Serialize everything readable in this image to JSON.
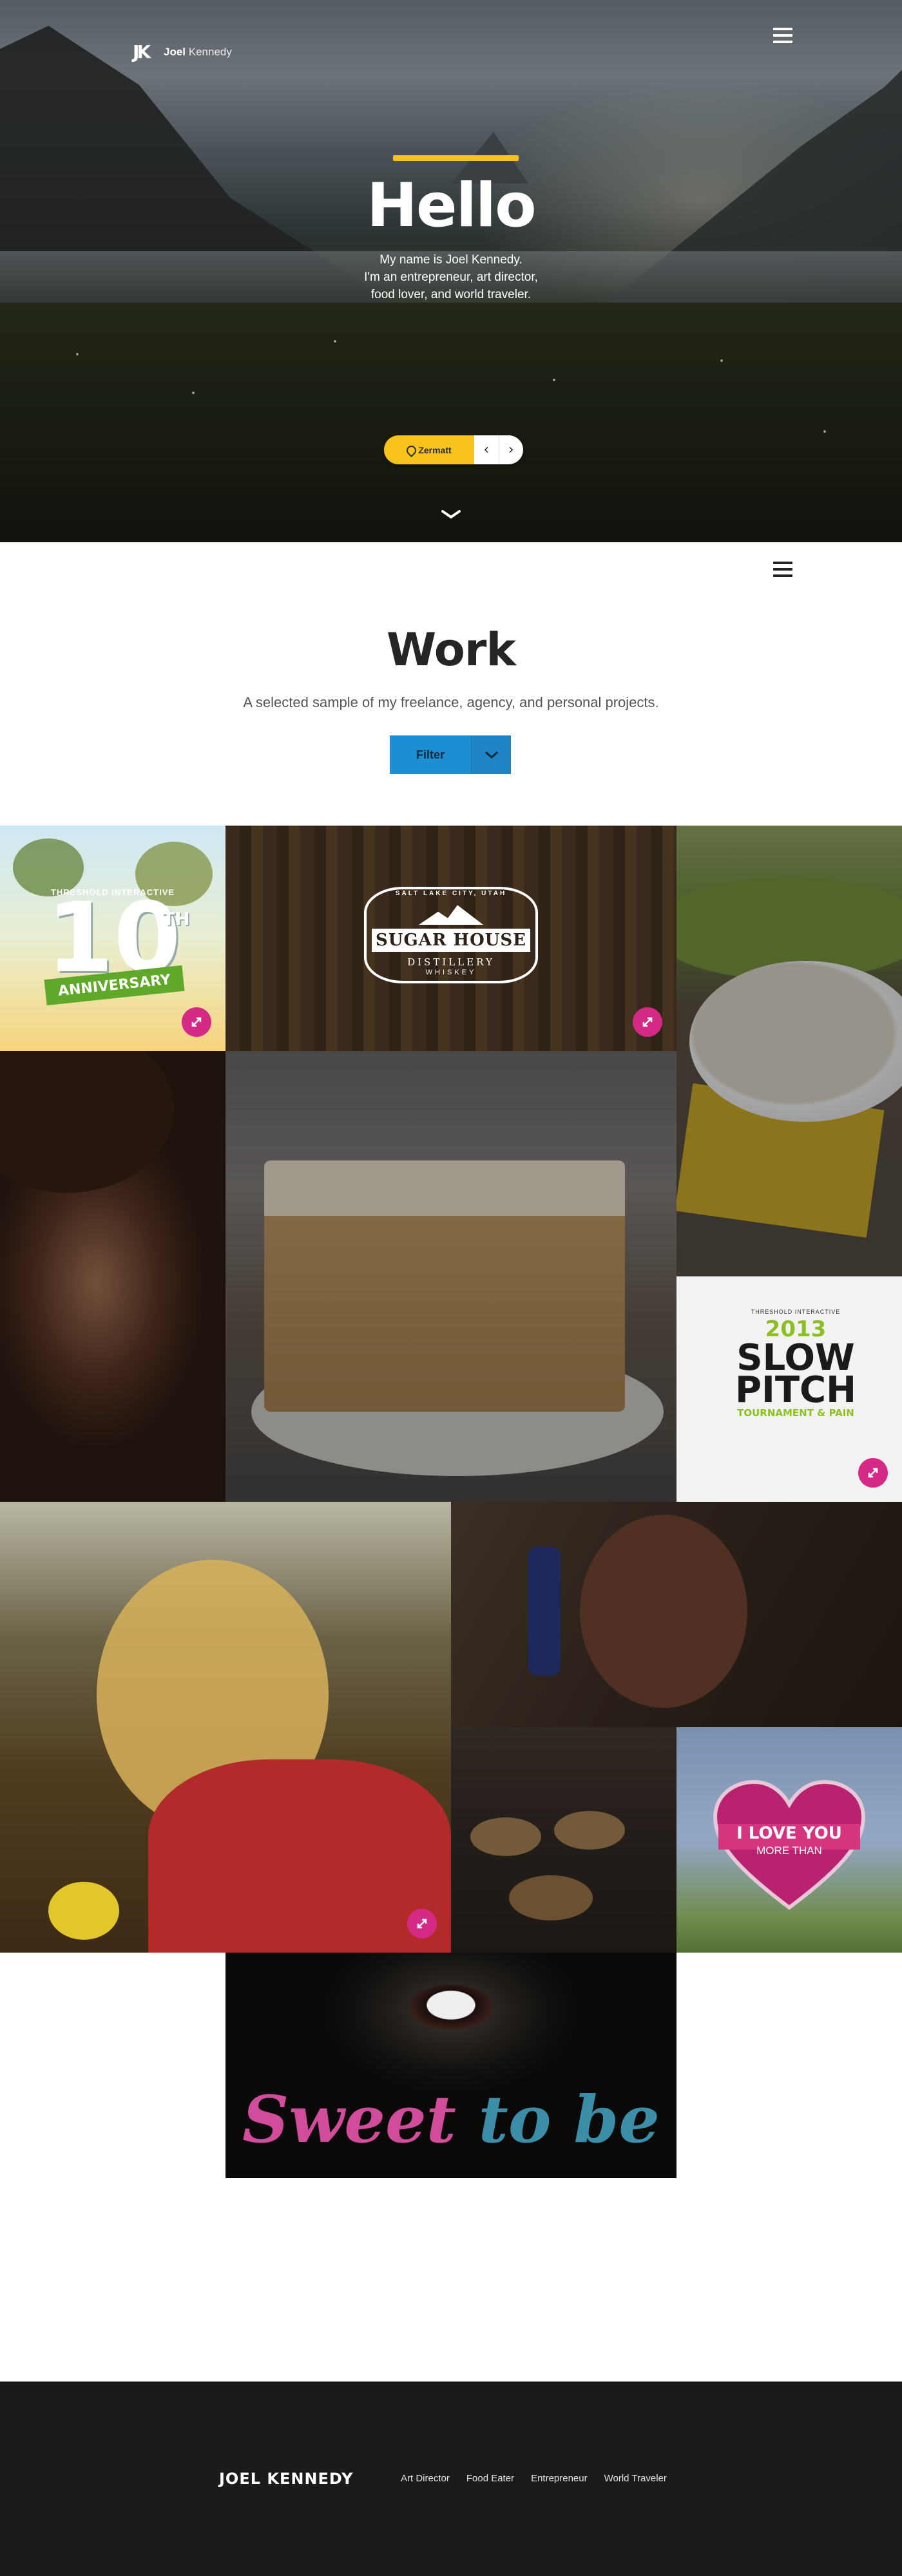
{
  "site": {
    "logo_first": "Joel",
    "logo_last": "Kennedy",
    "logo_mark": "JK"
  },
  "hero": {
    "title": "Hello",
    "subtitle_lines": [
      "My name is Joel Kennedy.",
      "I'm an entrepreneur, art director,",
      "food lover, and world traveler."
    ],
    "location_label": "Zermatt",
    "prev_icon": "chevron-left-icon",
    "next_icon": "chevron-right-icon",
    "scroll_icon": "chevron-down-icon",
    "accent_color": "#f7c31a"
  },
  "work": {
    "title": "Work",
    "subtitle": "A selected sample of my freelance, agency, and personal projects.",
    "filter_label": "Filter",
    "filter_color": "#1d8ed1",
    "expand_color": "#d42a85"
  },
  "tiles": {
    "anniversary": {
      "company": "THRESHOLD INTERACTIVE",
      "number": "10",
      "suffix": "TH",
      "banner": "ANNIVERSARY"
    },
    "sugar_house": {
      "top_text": "SALT LAKE CITY, UTAH",
      "name": "SUGAR HOUSE",
      "sub": "DISTILLERY",
      "product": "WHISKEY"
    },
    "slow_pitch": {
      "top_text": "THRESHOLD INTERACTIVE",
      "year": "2013",
      "title_1": "SLOW",
      "title_2": "PITCH",
      "tagline": "TOURNAMENT & PAIN"
    },
    "heart": {
      "line_1": "I LOVE YOU",
      "line_2": "MORE THAN"
    },
    "sweet": {
      "word_1": "Sweet",
      "word_2": "to be"
    }
  },
  "footer": {
    "brand": "JOEL KENNEDY",
    "links": [
      "Art Director",
      "Food Eater",
      "Entrepreneur",
      "World Traveler"
    ]
  }
}
